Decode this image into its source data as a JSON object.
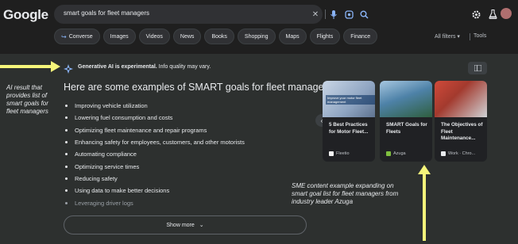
{
  "header": {
    "logo": "Google",
    "query": "smart goals for fleet managers"
  },
  "chips": [
    "Converse",
    "Images",
    "Videos",
    "News",
    "Books",
    "Shopping",
    "Maps",
    "Flights",
    "Finance"
  ],
  "filters_label": "All filters",
  "tools_label": "Tools",
  "ai": {
    "notice_bold": "Generative AI is experimental.",
    "notice_rest": " Info quality may vary.",
    "heading": "Here are some examples of SMART goals for fleet managers:",
    "items": [
      "Improving vehicle utilization",
      "Lowering fuel consumption and costs",
      "Optimizing fleet maintenance and repair programs",
      "Enhancing safety for employees, customers, and other motorists",
      "Automating compliance",
      "Optimizing service times",
      "Reducing safety",
      "Using data to make better decisions",
      "Leveraging driver logs"
    ],
    "show_more": "Show more"
  },
  "cards": [
    {
      "title": "5 Best Practices for Motor Fleet...",
      "source": "Fleetio",
      "img_text": "Improve your motor fleet management"
    },
    {
      "title": "SMART Goals for Fleets",
      "source": "Azuga",
      "img_text": ""
    },
    {
      "title": "The Objectives of Fleet Maintenance...",
      "source": "Work · Chro...",
      "img_text": ""
    }
  ],
  "annotations": {
    "left": "AI result that provides list of smart goals for fleet managers",
    "bottom": "SME content example expanding on smart goal list for fleet managers from industry leader Azuga"
  },
  "colors": {
    "accent": "#8ab4f8",
    "annotation": "#f5f57a",
    "panel": "#2d302f"
  }
}
